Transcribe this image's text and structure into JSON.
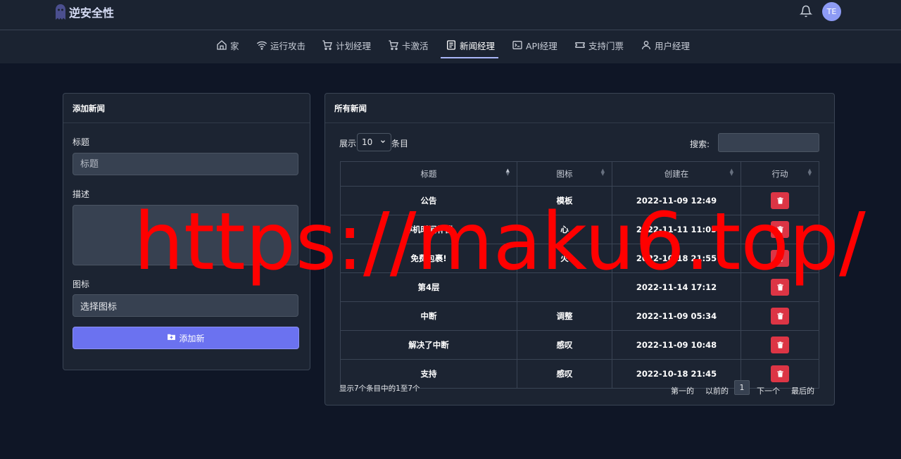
{
  "app": {
    "brand": "逆安全性",
    "avatar_initials": "TE"
  },
  "nav": {
    "items": [
      {
        "label": "家",
        "icon": "home-icon"
      },
      {
        "label": "运行攻击",
        "icon": "wifi-icon"
      },
      {
        "label": "计划经理",
        "icon": "cart-icon"
      },
      {
        "label": "卡激活",
        "icon": "cart-icon"
      },
      {
        "label": "新闻经理",
        "icon": "news-icon",
        "active": true
      },
      {
        "label": "API经理",
        "icon": "terminal-icon"
      },
      {
        "label": "支持门票",
        "icon": "ticket-icon"
      },
      {
        "label": "用户经理",
        "icon": "users-icon"
      }
    ]
  },
  "add_news": {
    "title": "添加新闻",
    "title_label": "标题",
    "title_placeholder": "标题",
    "description_label": "描述",
    "icon_label": "图标",
    "icon_select_value": "选择图标",
    "submit_label": "添加新"
  },
  "all_news": {
    "title": "所有新闻",
    "length_prefix": "展示",
    "length_value": "10",
    "length_suffix": "条目",
    "search_label": "搜索:",
    "columns": [
      "标题",
      "图标",
      "创建在",
      "行动"
    ],
    "rows": [
      {
        "title": "公告",
        "icon": "模板",
        "created": "2022-11-09 12:49"
      },
      {
        "title": "停机时间补偿",
        "icon": "心",
        "created": "2022-11-11 11:05"
      },
      {
        "title": "免费包裹!",
        "icon": "火",
        "created": "2022-10-18 21:55"
      },
      {
        "title": "第4层",
        "icon": "",
        "created": "2022-11-14 17:12"
      },
      {
        "title": "中断",
        "icon": "调整",
        "created": "2022-11-09 05:34"
      },
      {
        "title": "解决了中断",
        "icon": "感叹",
        "created": "2022-11-09 10:48"
      },
      {
        "title": "支持",
        "icon": "感叹",
        "created": "2022-10-18 21:45"
      }
    ],
    "info": "显示7个条目中的1至7个",
    "pagination": {
      "first": "第一的",
      "previous": "以前的",
      "current": "1",
      "next": "下一个",
      "last": "最后的"
    }
  },
  "watermark": "https://maku6.top/",
  "colors": {
    "accent": "#6b72f0",
    "danger": "#dc3545",
    "background": "#0f1626",
    "card": "#1c2432"
  }
}
